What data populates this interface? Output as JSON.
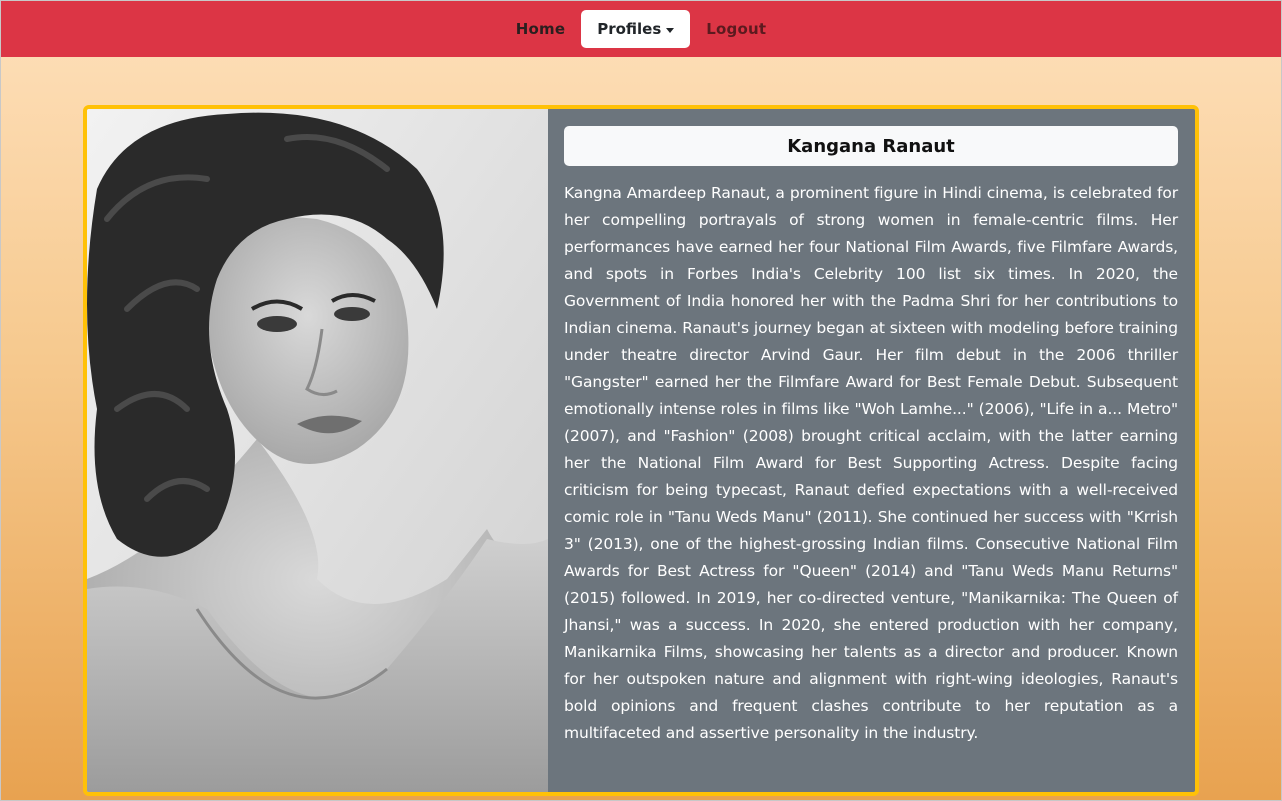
{
  "nav": {
    "home_label": "Home",
    "profiles_label": "Profiles",
    "logout_label": "Logout"
  },
  "profile": {
    "name": "Kangana Ranaut",
    "bio": "Kangna Amardeep Ranaut, a prominent figure in Hindi cinema, is celebrated for her compelling portrayals of strong women in female-centric films. Her performances have earned her four National Film Awards, five Filmfare Awards, and spots in Forbes India's Celebrity 100 list six times. In 2020, the Government of India honored her with the Padma Shri for her contributions to Indian cinema. Ranaut's journey began at sixteen with modeling before training under theatre director Arvind Gaur. Her film debut in the 2006 thriller \"Gangster\" earned her the Filmfare Award for Best Female Debut. Subsequent emotionally intense roles in films like \"Woh Lamhe...\" (2006), \"Life in a... Metro\" (2007), and \"Fashion\" (2008) brought critical acclaim, with the latter earning her the National Film Award for Best Supporting Actress. Despite facing criticism for being typecast, Ranaut defied expectations with a well-received comic role in \"Tanu Weds Manu\" (2011). She continued her success with \"Krrish 3\" (2013), one of the highest-grossing Indian films. Consecutive National Film Awards for Best Actress for \"Queen\" (2014) and \"Tanu Weds Manu Returns\" (2015) followed. In 2019, her co-directed venture, \"Manikarnika: The Queen of Jhansi,\" was a success. In 2020, she entered production with her company, Manikarnika Films, showcasing her talents as a director and producer. Known for her outspoken nature and alignment with right-wing ideologies, Ranaut's bold opinions and frequent clashes contribute to her reputation as a multifaceted and assertive personality in the industry."
  },
  "colors": {
    "navbar": "#dc3545",
    "card_border": "#ffc107",
    "card_bg": "#6c757d"
  },
  "icons": {
    "dropdown": "caret-down-icon"
  }
}
